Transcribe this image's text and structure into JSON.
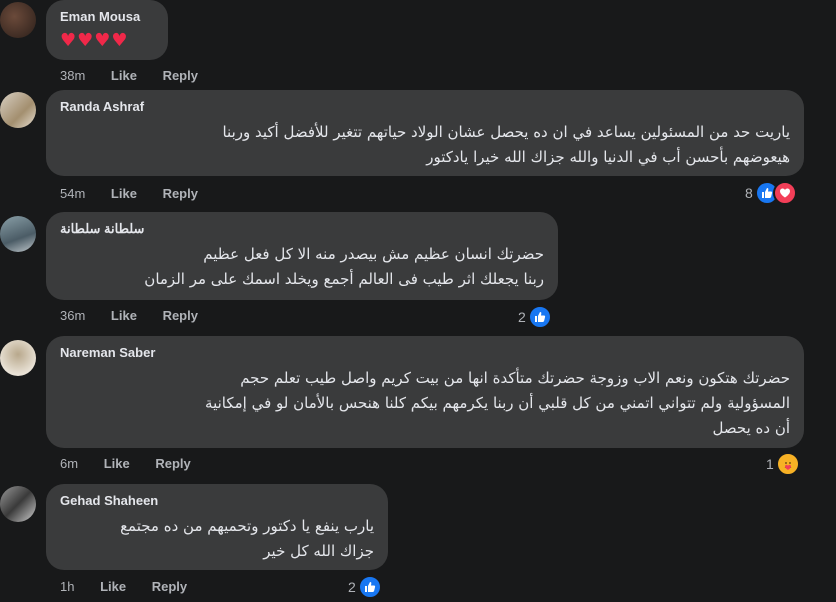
{
  "comments": [
    {
      "author": "Eman Mousa",
      "text": "♥♥♥♥",
      "time": "38m",
      "like": "Like",
      "reply": "Reply",
      "reaction_count": ""
    },
    {
      "author": "Randa Ashraf",
      "text_lines": [
        "ياريت حد من المسئولين يساعد في ان ده يحصل عشان الولاد حياتهم تتغير للأفضل أكيد وربنا",
        "هيعوضهم بأحسن أب في الدنيا والله جزاك الله خيرا يادكتور"
      ],
      "time": "54m",
      "like": "Like",
      "reply": "Reply",
      "reaction_count": "8"
    },
    {
      "author": "سلطانة سلطانة",
      "text_lines": [
        "حضرتك انسان عظيم مش بيصدر منه الا كل فعل عظيم",
        "ربنا يجعلك اثر طيب فى العالم أجمع ويخلد اسمك على مر الزمان"
      ],
      "time": "36m",
      "like": "Like",
      "reply": "Reply",
      "reaction_count": "2"
    },
    {
      "author": "Nareman Saber",
      "text_lines": [
        "حضرتك هتكون ونعم الاب وزوجة حضرتك متأكدة انها من بيت كريم واصل طيب تعلم حجم",
        "المسؤولية ولم تتواني اتمني من كل قلبي أن ربنا يكرمهم بيكم كلنا هنحس بالأمان لو في إمكانية",
        "أن ده يحصل"
      ],
      "time": "6m",
      "like": "Like",
      "reply": "Reply",
      "reaction_count": "1"
    },
    {
      "author": "Gehad Shaheen",
      "text_lines": [
        "يارب ينفع يا دكتور وتحميهم من ده مجتمع",
        "جزاك الله كل خير"
      ],
      "time": "1h",
      "like": "Like",
      "reply": "Reply",
      "reaction_count": "2"
    }
  ],
  "colors": {
    "background": "#18191a",
    "bubble": "#3a3b3c",
    "like_blue": "#1877f2",
    "love_red": "#f33e58",
    "care_yellow": "#f7b125"
  },
  "icons": [
    "like-icon",
    "love-icon",
    "care-icon"
  ]
}
